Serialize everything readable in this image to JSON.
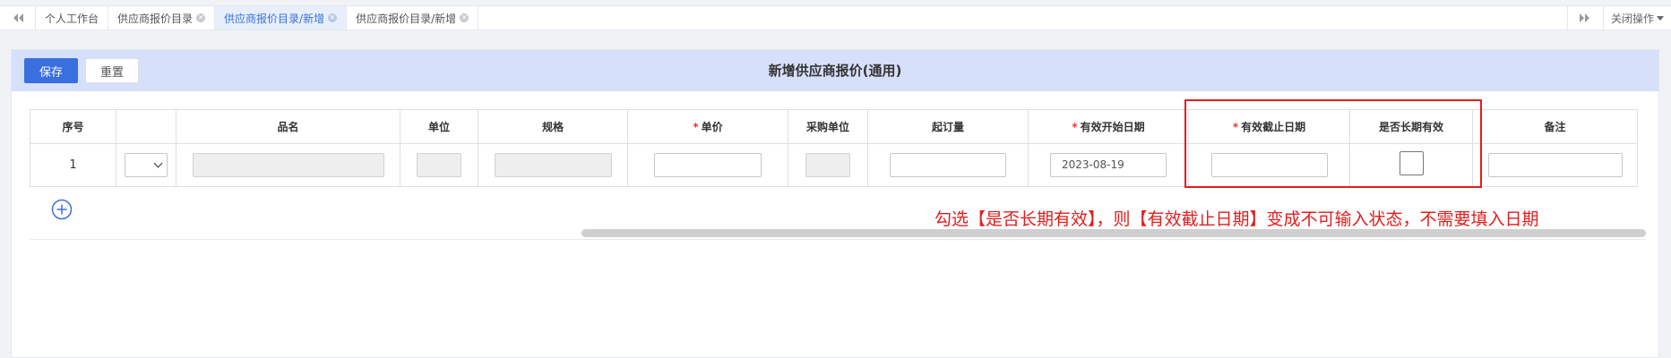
{
  "tabs": [
    {
      "label": "个人工作台",
      "closable": false,
      "active": false
    },
    {
      "label": "供应商报价目录",
      "closable": true,
      "active": false
    },
    {
      "label": "供应商报价目录/新增",
      "closable": true,
      "active": true
    },
    {
      "label": "供应商报价目录/新增",
      "closable": true,
      "active": false
    }
  ],
  "tabbar": {
    "close_ops_label": "关闭操作"
  },
  "toolbar": {
    "save_label": "保存",
    "reset_label": "重置"
  },
  "panel": {
    "title": "新增供应商报价(通用)"
  },
  "table": {
    "columns": [
      {
        "label": "序号",
        "required": false
      },
      {
        "label": "",
        "required": false
      },
      {
        "label": "品名",
        "required": false
      },
      {
        "label": "单位",
        "required": false
      },
      {
        "label": "规格",
        "required": false
      },
      {
        "label": "单价",
        "required": true
      },
      {
        "label": "采购单位",
        "required": false
      },
      {
        "label": "起订量",
        "required": false
      },
      {
        "label": "有效开始日期",
        "required": true
      },
      {
        "label": "有效截止日期",
        "required": true
      },
      {
        "label": "是否长期有效",
        "required": false
      },
      {
        "label": "备注",
        "required": false
      }
    ],
    "rows": [
      {
        "index": "1",
        "start_date": "2023-08-19",
        "long_term_checked": false
      }
    ]
  },
  "annotation": {
    "text": "勾选【是否长期有效】，则【有效截止日期】变成不可输入状态，不需要填入日期"
  },
  "colors": {
    "accent": "#3a6fe0",
    "header_band": "#d6e0fb",
    "annotation": "#e21d1d",
    "active_tab": "#e8effc"
  },
  "icons": {
    "nav_prev": "double-chevron-left-icon",
    "nav_next": "double-chevron-right-icon",
    "add_row": "plus-circle-icon",
    "tab_close": "close-circle-icon"
  }
}
